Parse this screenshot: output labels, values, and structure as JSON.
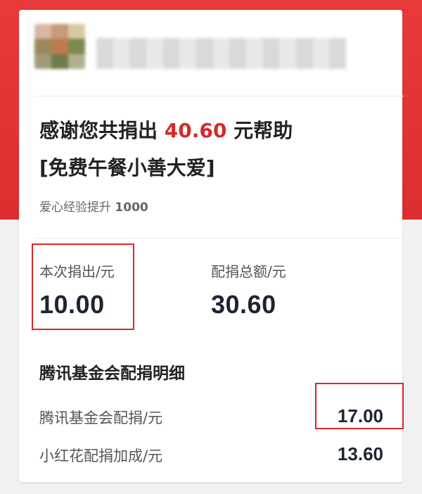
{
  "summary": {
    "thank_prefix": "感谢您共捐出 ",
    "total_amount": "40.60",
    "thank_suffix": " 元帮助",
    "project_name": "[免费午餐小善大爱]",
    "exp_label": "爱心经验提升 ",
    "exp_value": "1000"
  },
  "donation": {
    "this_label": "本次捐出/元",
    "this_value": "10.00",
    "match_label": "配捐总额/元",
    "match_value": "30.60"
  },
  "details": {
    "title": "腾讯基金会配捐明细",
    "rows": [
      {
        "label": "腾讯基金会配捐/元",
        "value": "17.00"
      },
      {
        "label": "小红花配捐加成/元",
        "value": "13.60"
      }
    ]
  },
  "colors": {
    "accent_red": "#d6282b",
    "header_bg": "#e83a3a",
    "highlight": "#e02424"
  }
}
